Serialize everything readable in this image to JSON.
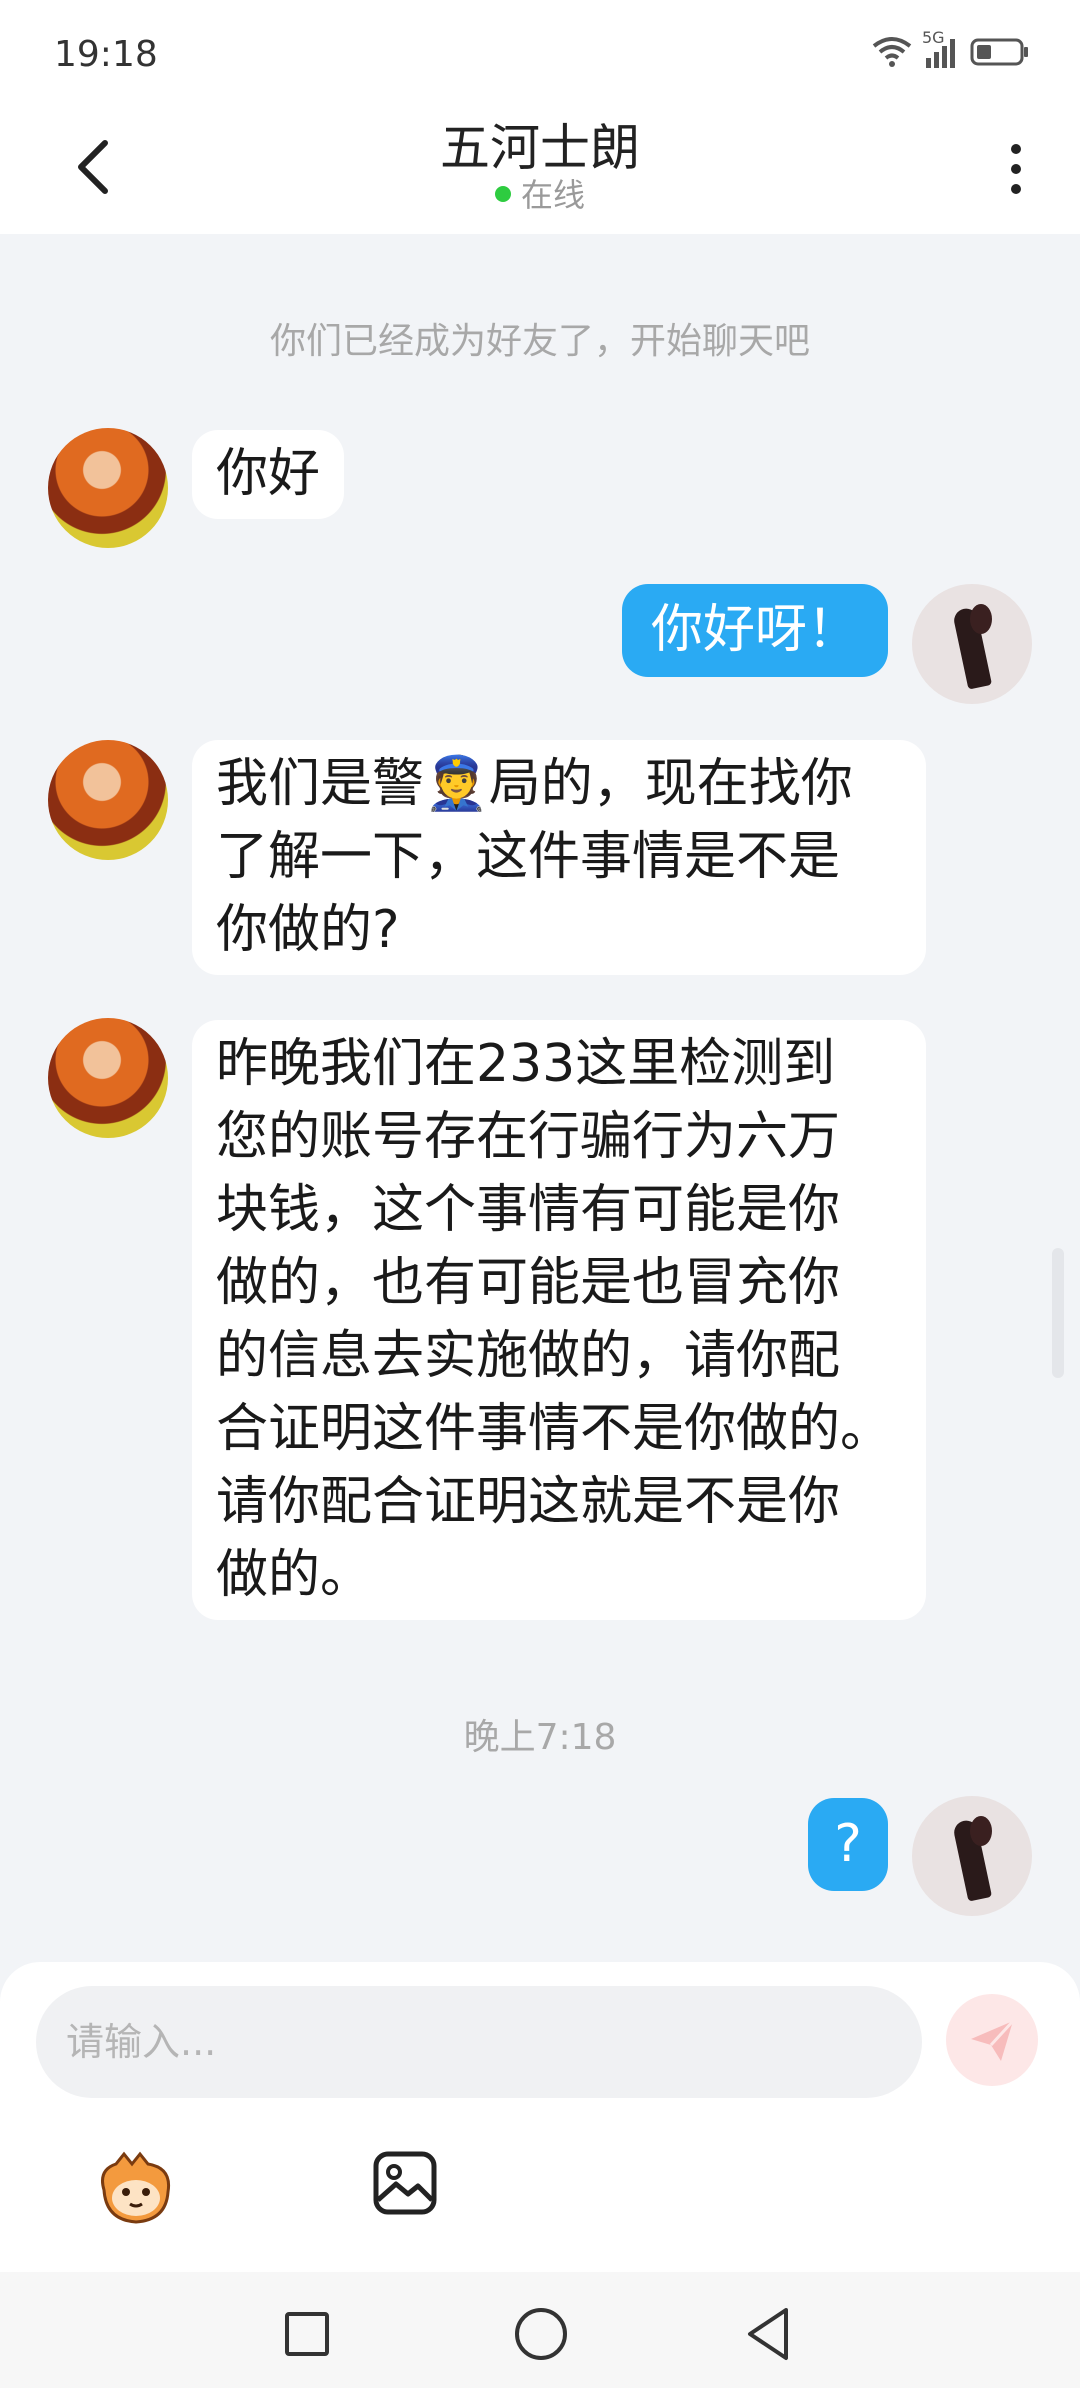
{
  "status_bar": {
    "time": "19:18",
    "network_label": "5G",
    "icons": [
      "wifi-icon",
      "cellular-signal-icon",
      "battery-icon"
    ]
  },
  "header": {
    "title": "五河士朗",
    "presence": "在线",
    "presence_color": "#2ecc40",
    "back_icon": "chevron-left-icon",
    "more_icon": "more-vertical-icon"
  },
  "chat": {
    "system_note": "你们已经成为好友了，开始聊天吧",
    "messages": [
      {
        "side": "incoming",
        "text": "你好"
      },
      {
        "side": "outgoing",
        "text": "你好呀！"
      },
      {
        "side": "incoming",
        "lines": [
          "我们是警👮局的，现在找你",
          "了解一下，这件事情是不是",
          "你做的?"
        ]
      },
      {
        "side": "incoming",
        "lines": [
          "昨晚我们在233这里检测到",
          "您的账号存在行骗行为六万",
          "块钱，这个事情有可能是你",
          "做的，也有可能是也冒充你",
          "的信息去实施做的，请你配",
          "合证明这件事情不是你做的。",
          "请你配合证明这就是不是你",
          "做的。"
        ]
      },
      {
        "side": "outgoing",
        "text": "?"
      }
    ],
    "time_divider": "晚上7:18"
  },
  "composer": {
    "placeholder": "请输入...",
    "value": "",
    "send_icon": "send-icon",
    "emoji_icon": "emoji-mascot-icon",
    "image_icon": "image-icon"
  },
  "colors": {
    "outgoing_bubble": "#2aaaf3",
    "incoming_bubble": "#ffffff",
    "background": "#f2f4f7"
  },
  "nav_bar": {
    "icons": [
      "recents-square-icon",
      "home-circle-icon",
      "back-triangle-icon"
    ]
  }
}
